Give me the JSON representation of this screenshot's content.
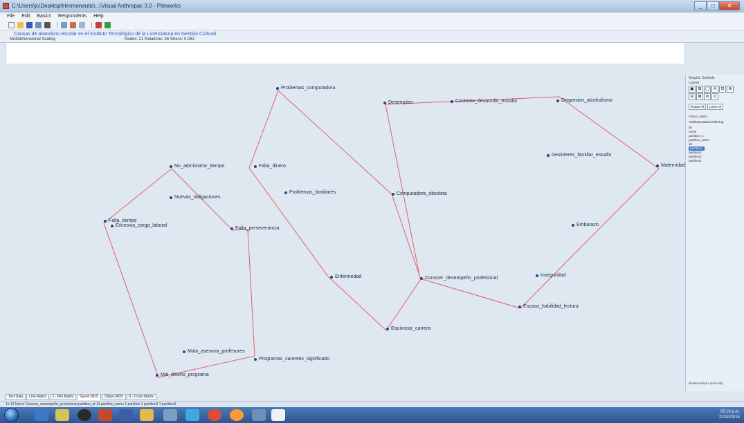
{
  "window": {
    "title": "C:\\Users\\jc\\Desktop\\Hermeneutic\\...\\Visual Anthropac 3.0 - Pileworks",
    "buttons": {
      "min": "_",
      "max": "□",
      "close": "✕"
    }
  },
  "menu": [
    "File",
    "Edit",
    "Basics",
    "Respondents",
    "Help"
  ],
  "network": {
    "link": "Causas de abandono escolar en el Instituto Tecnológico de la Licenciatura en Gestión Cultural",
    "view": "Multidimensional Scaling",
    "stats": "Nodes: 21  Relations: 36  Stress: 0.082"
  },
  "nodes": [
    {
      "label": "Problemas_computadora"
    },
    {
      "label": "Desempleo"
    },
    {
      "label": "Contexto_desarrollo_estudio"
    },
    {
      "label": "Disgresion_alcoholismo"
    },
    {
      "label": "Desinteres_familiar_estudio"
    },
    {
      "label": "Maternidad"
    },
    {
      "label": "No_administrar_tiempo"
    },
    {
      "label": "Falta_dinero"
    },
    {
      "label": "Nuevas_obligaciones"
    },
    {
      "label": "Problemas_familiares"
    },
    {
      "label": "Computadora_obsoleta"
    },
    {
      "label": "Falta_tiempo"
    },
    {
      "label": "Excesiva_carga_laboral"
    },
    {
      "label": "Falta_perseverancia"
    },
    {
      "label": "Embarazo"
    },
    {
      "label": "Enfermedad"
    },
    {
      "label": "Conocer_desempeño_profesional"
    },
    {
      "label": "Inseguridad"
    },
    {
      "label": "Escasa_habilidad_lectura"
    },
    {
      "label": "Equivocar_carrera"
    },
    {
      "label": "Mala_asesoria_profesores"
    },
    {
      "label": "Programas_carentes_significado"
    },
    {
      "label": "Mal_diseño_programa"
    }
  ],
  "side": {
    "header": "Graphic Controls",
    "header2": "Layout",
    "palette": [
      "▣",
      "⊞",
      "◯",
      "A",
      "⊡",
      "⊛",
      "⊟",
      "⊠",
      "⊘",
      "⊙"
    ],
    "buttons": [
      "Rotate All",
      "Lines All"
    ],
    "subtabs": "Filters   Labels",
    "attr_header": "Attributes Based Filtering",
    "attrs": [
      "all",
      "name",
      "partition_A",
      "partition_name",
      "all",
      "partition1",
      "partition2",
      "partition3",
      "partition4"
    ],
    "bottom": "Relationships   Lines   Help"
  },
  "tabs": [
    "Text Data",
    "Line Matrix",
    "1 - Pile Matrix",
    "Saved MDS",
    "Clique MDS",
    "5 - Cross Matrix"
  ],
  "status": "1e 13 Name Conocer_desempeño_profesional  partition_id 13  partition_name 1  partition 1  partition2 1  partition3",
  "tray": {
    "time": "03:10 p.m.",
    "date": "22/10/2014"
  }
}
